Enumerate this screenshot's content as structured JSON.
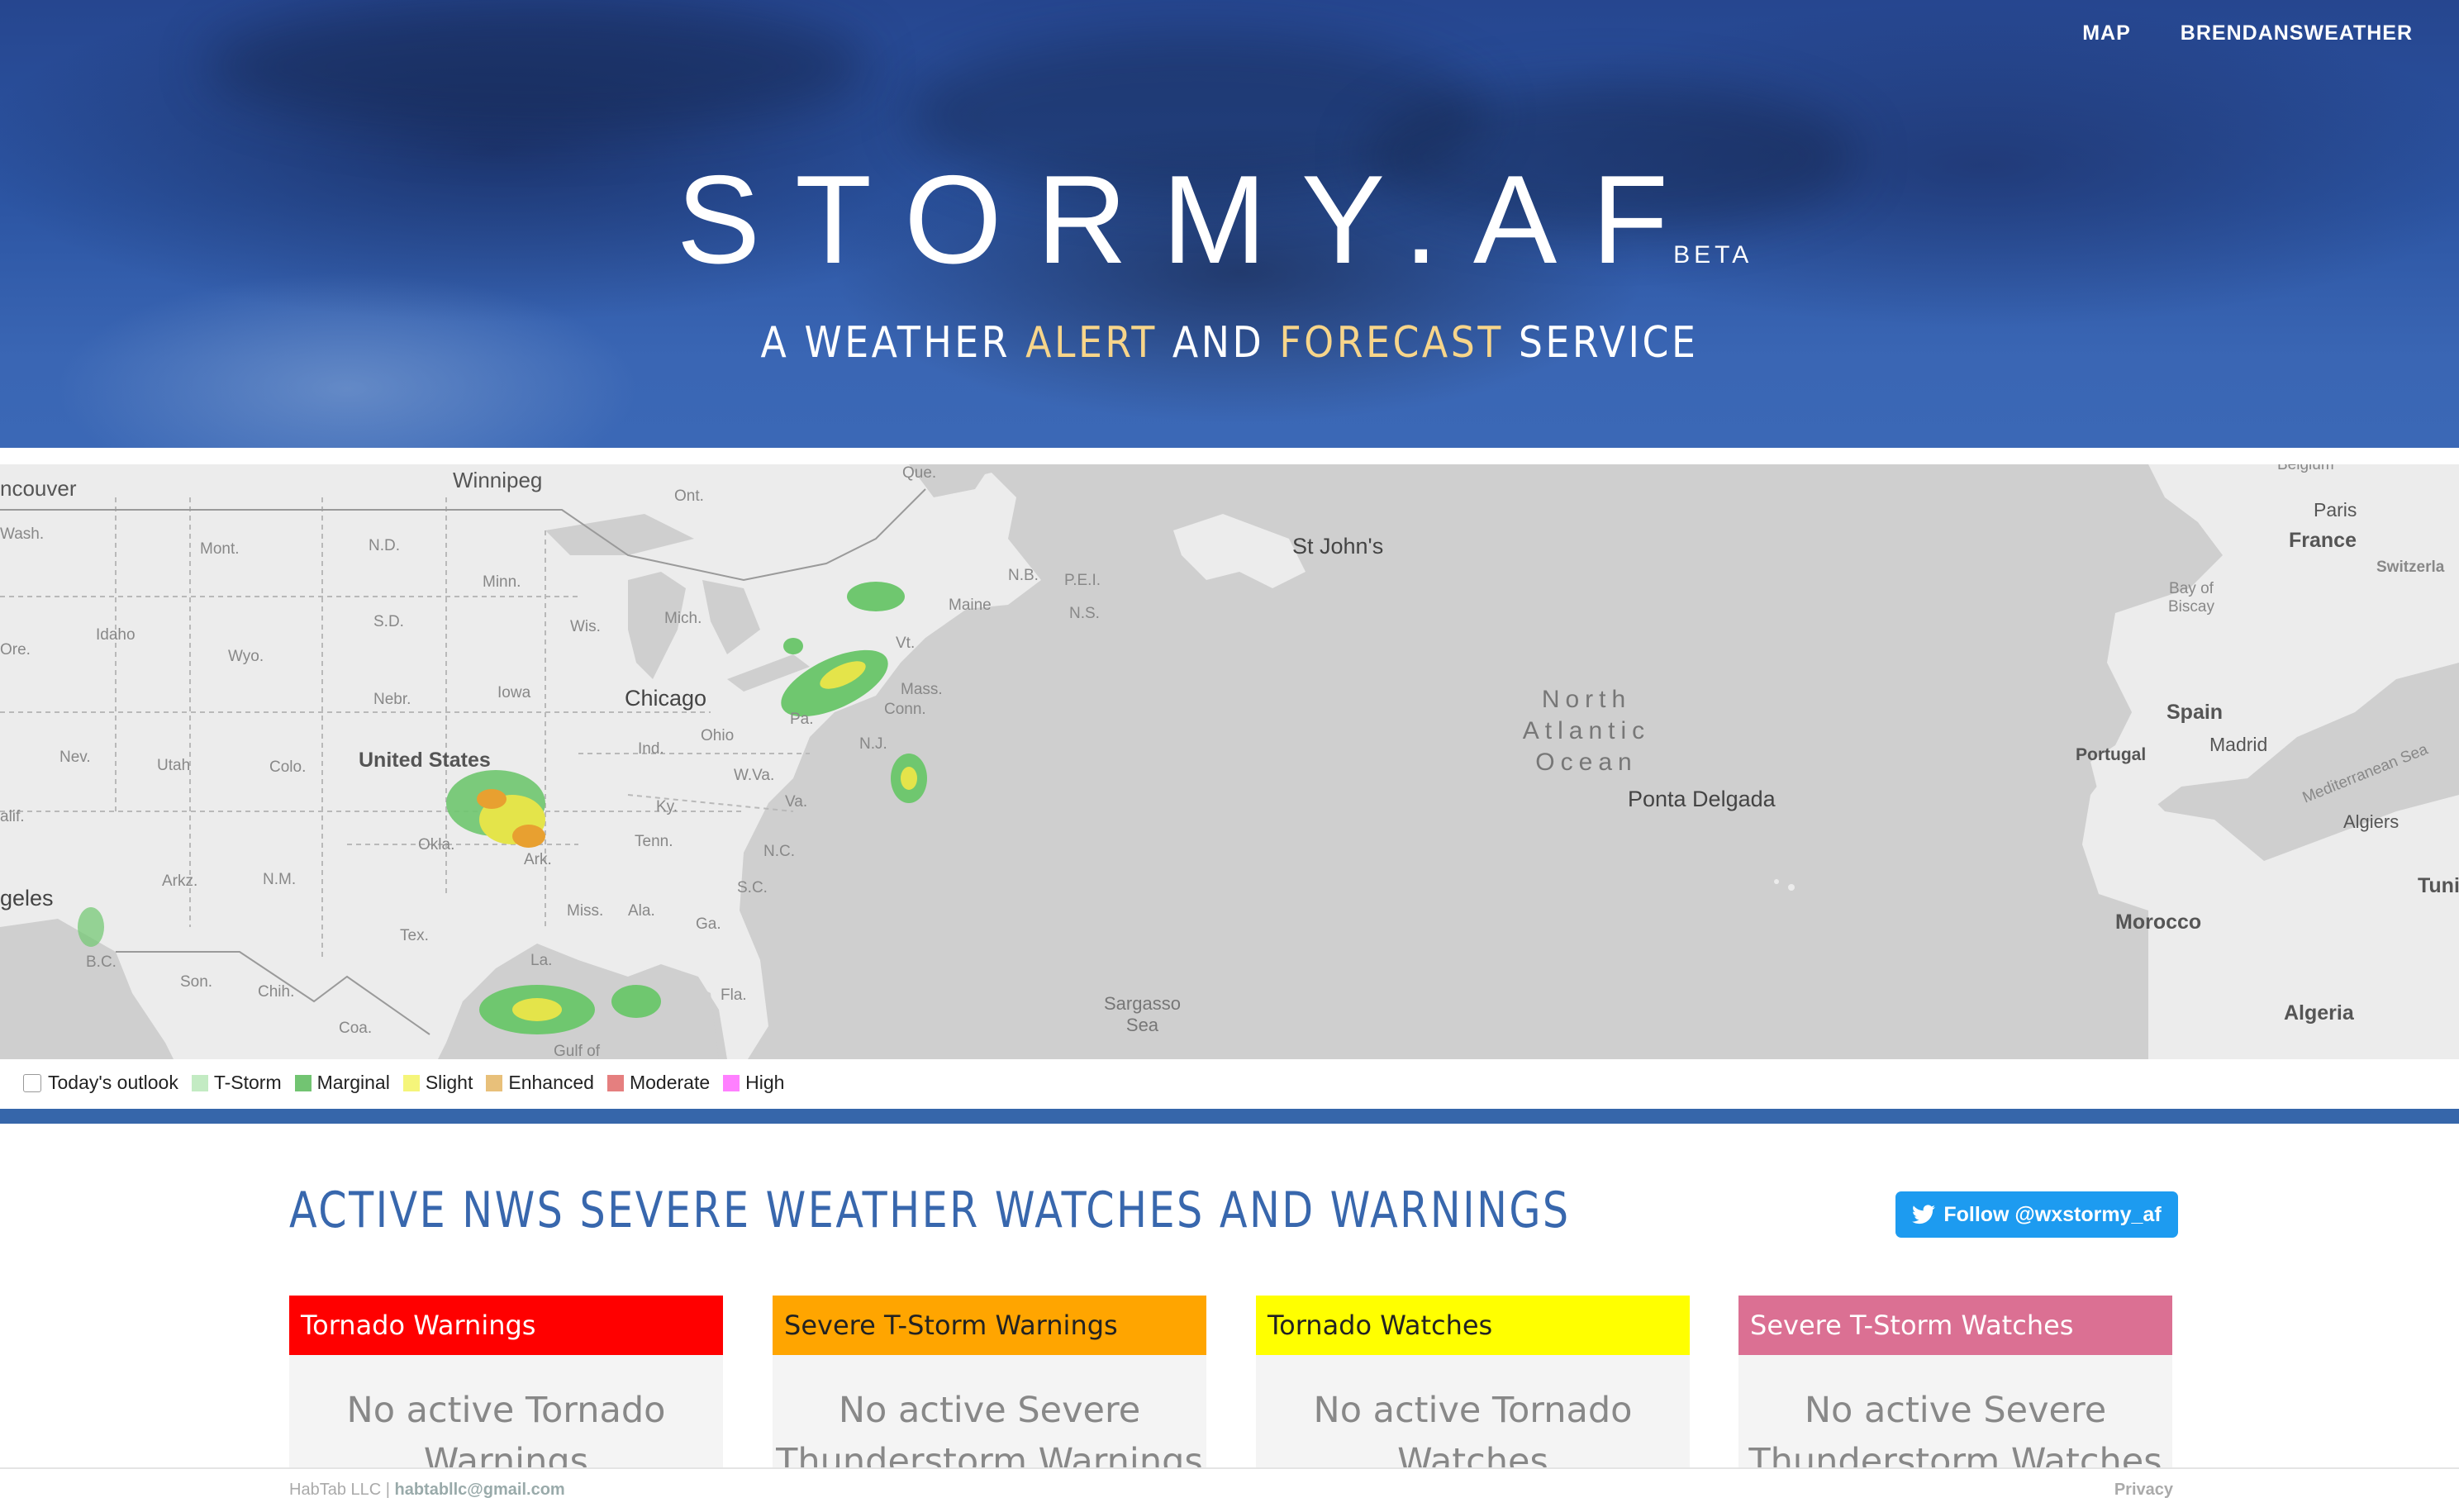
{
  "nav": {
    "map": "MAP",
    "brand": "BRENDANSWEATHER"
  },
  "hero": {
    "title": "STORMY.AF",
    "beta": "BETA",
    "tagline_1": "A WEATHER ",
    "tagline_alert": "ALERT",
    "tagline_2": " AND ",
    "tagline_forecast": "FORECAST",
    "tagline_3": " SERVICE"
  },
  "map": {
    "labels": {
      "winnipeg": "Winnipeg",
      "vancouver": "ncouver",
      "wash": "Wash.",
      "mont": "Mont.",
      "nd": "N.D.",
      "minn": "Minn.",
      "ont": "Ont.",
      "que": "Que.",
      "ore": "Ore.",
      "idaho": "Idaho",
      "wyo": "Wyo.",
      "sd": "S.D.",
      "wis": "Wis.",
      "mich": "Mich.",
      "nebr": "Nebr.",
      "iowa": "Iowa",
      "chicago": "Chicago",
      "nev": "Nev.",
      "utah": "Utah",
      "colo": "Colo.",
      "united_states": "United States",
      "ohio": "Ohio",
      "pa": "Pa.",
      "ind": "Ind.",
      "wva": "W.Va.",
      "va": "Va.",
      "ky": "Ky.",
      "tenn": "Tenn.",
      "nc": "N.C.",
      "okla": "Okla.",
      "ark": "Ark.",
      "arkz": "Arkz.",
      "nm": "N.M.",
      "calif": "alif.",
      "angeles": "geles",
      "miss": "Miss.",
      "ala": "Ala.",
      "ga": "Ga.",
      "sc": "S.C.",
      "tex": "Tex.",
      "la": "La.",
      "fla": "Fla.",
      "son": "Son.",
      "chih": "Chih.",
      "coa": "Coa.",
      "bc": "B.C.",
      "maine": "Maine",
      "nb": "N.B.",
      "pei": "P.E.I.",
      "ns": "N.S.",
      "vt": "Vt.",
      "mass": "Mass.",
      "conn": "Conn.",
      "nj": "N.J.",
      "st_johns": "St John's",
      "ocean_1": "North",
      "ocean_2": "Atlantic",
      "ocean_3": "Ocean",
      "ponta_delgada": "Ponta Delgada",
      "sargasso_1": "Sargasso",
      "sargasso_2": "Sea",
      "belgium": "Belgium",
      "paris": "Paris",
      "france": "France",
      "switzerland": "Switzerla",
      "bay_1": "Bay of",
      "bay_2": "Biscay",
      "spain": "Spain",
      "madrid": "Madrid",
      "portugal": "Portugal",
      "med": "Mediterranean Sea",
      "algiers": "Algiers",
      "morocco": "Morocco",
      "algeria": "Algeria",
      "tunis": "Tuni",
      "gulf": "Gulf of"
    }
  },
  "legend": {
    "items": [
      {
        "label": "Today's outlook",
        "checkbox": true
      },
      {
        "label": "T-Storm",
        "color": "#c3ebc3"
      },
      {
        "label": "Marginal",
        "color": "#72c472"
      },
      {
        "label": "Slight",
        "color": "#f5f57a"
      },
      {
        "label": "Enhanced",
        "color": "#e8c07a"
      },
      {
        "label": "Moderate",
        "color": "#e57f7f"
      },
      {
        "label": "High",
        "color": "#ff80ff"
      }
    ]
  },
  "main": {
    "title": "ACTIVE NWS SEVERE WEATHER WATCHES AND WARNINGS",
    "follow_label": "Follow @wxstormy_af",
    "cards": [
      {
        "title": "Tornado Warnings",
        "color": "#ff0000",
        "title_color": "#ffffff",
        "line_1": "No active Tornado",
        "line_2": "Warnings"
      },
      {
        "title": "Severe T-Storm Warnings",
        "color": "#ffa500",
        "title_color": "#222222",
        "line_1": "No active Severe",
        "line_2": "Thunderstorm Warnings"
      },
      {
        "title": "Tornado Watches",
        "color": "#ffff00",
        "title_color": "#222222",
        "line_1": "No active Tornado",
        "line_2": "Watches"
      },
      {
        "title": "Severe T-Storm Watches",
        "color": "#db7093",
        "title_color": "#ffffff",
        "line_1": "No active Severe",
        "line_2": "Thunderstorm Watches"
      }
    ]
  },
  "footer": {
    "company": "HabTab LLC | ",
    "email": "habtabllc@gmail.com",
    "privacy": "Privacy"
  }
}
